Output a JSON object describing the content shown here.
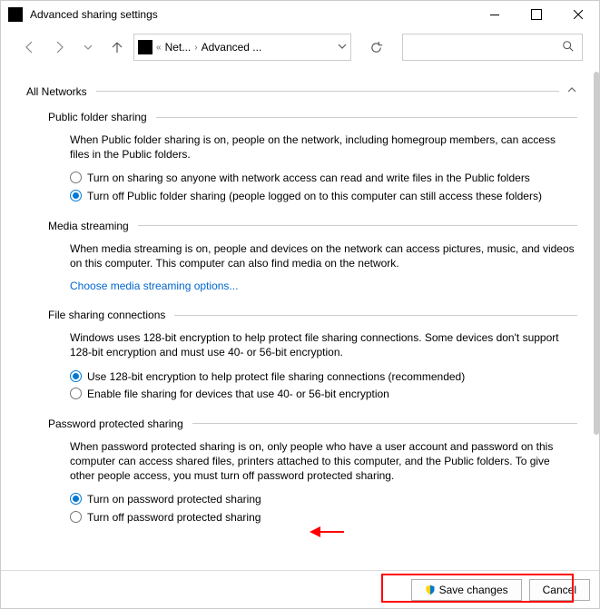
{
  "window": {
    "title": "Advanced sharing settings"
  },
  "breadcrumbs": {
    "seg1": "Net...",
    "seg2": "Advanced ..."
  },
  "profile": {
    "title": "All Networks"
  },
  "sections": {
    "pfs": {
      "title": "Public folder sharing",
      "desc": "When Public folder sharing is on, people on the network, including homegroup members, can access files in the Public folders.",
      "opt1": "Turn on sharing so anyone with network access can read and write files in the Public folders",
      "opt2": "Turn off Public folder sharing (people logged on to this computer can still access these folders)"
    },
    "ms": {
      "title": "Media streaming",
      "desc": "When media streaming is on, people and devices on the network can access pictures, music, and videos on this computer. This computer can also find media on the network.",
      "link": "Choose media streaming options..."
    },
    "fsc": {
      "title": "File sharing connections",
      "desc": "Windows uses 128-bit encryption to help protect file sharing connections. Some devices don't support 128-bit encryption and must use 40- or 56-bit encryption.",
      "opt1": "Use 128-bit encryption to help protect file sharing connections (recommended)",
      "opt2": "Enable file sharing for devices that use 40- or 56-bit encryption"
    },
    "pps": {
      "title": "Password protected sharing",
      "desc": "When password protected sharing is on, only people who have a user account and password on this computer can access shared files, printers attached to this computer, and the Public folders. To give other people access, you must turn off password protected sharing.",
      "opt1": "Turn on password protected sharing",
      "opt2": "Turn off password protected sharing"
    }
  },
  "footer": {
    "save": "Save changes",
    "cancel": "Cancel"
  }
}
